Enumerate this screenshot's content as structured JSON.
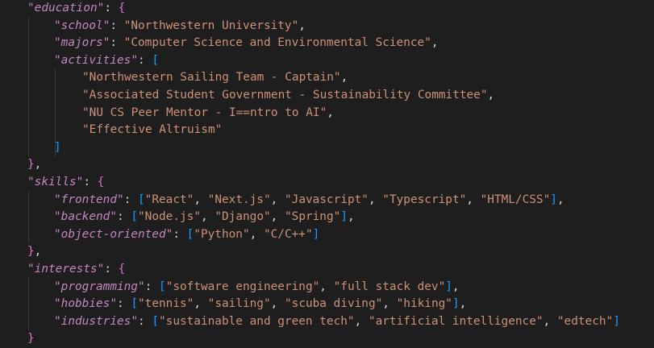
{
  "education": {
    "key": "education",
    "school_key": "school",
    "school": "Northwestern University",
    "majors_key": "majors",
    "majors": "Computer Science and Environmental Science",
    "activities_key": "activities",
    "activities": [
      "Northwestern Sailing Team - Captain",
      "Associated Student Government - Sustainability Committee",
      "NU CS Peer Mentor - I==ntro to AI",
      "Effective Altruism"
    ]
  },
  "skills": {
    "key": "skills",
    "frontend_key": "frontend",
    "frontend": [
      "React",
      "Next.js",
      "Javascript",
      "Typescript",
      "HTML/CSS"
    ],
    "backend_key": "backend",
    "backend": [
      "Node.js",
      "Django",
      "Spring"
    ],
    "oo_key": "object-oriented",
    "oo": [
      "Python",
      "C/C++"
    ]
  },
  "interests": {
    "key": "interests",
    "programming_key": "programming",
    "programming": [
      "software engineering",
      "full stack dev"
    ],
    "hobbies_key": "hobbies",
    "hobbies": [
      "tennis",
      "sailing",
      "scuba diving",
      "hiking"
    ],
    "industries_key": "industries",
    "industries": [
      "sustainable and green tech",
      "artificial intelligence",
      "edtech"
    ]
  },
  "colors": {
    "background": "#1e1e1e",
    "key": "#c586c0",
    "string": "#ce9178",
    "brace": "#da70d6",
    "bracket": "#179fff"
  }
}
